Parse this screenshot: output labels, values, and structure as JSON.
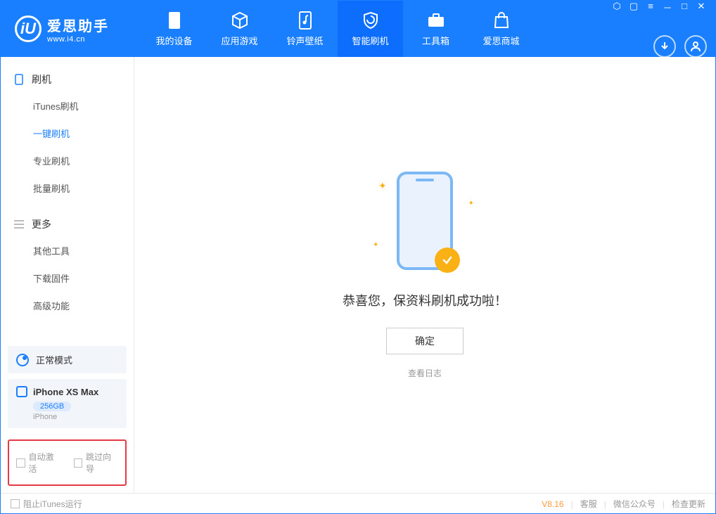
{
  "app": {
    "title": "爱思助手",
    "subtitle": "www.i4.cn"
  },
  "nav": {
    "mydevice": "我的设备",
    "apps": "应用游戏",
    "ringtone": "铃声壁纸",
    "flash": "智能刷机",
    "toolbox": "工具箱",
    "store": "爱思商城"
  },
  "sidebar": {
    "section_flash": "刷机",
    "items_flash": {
      "itunes": "iTunes刷机",
      "onekey": "一键刷机",
      "pro": "专业刷机",
      "batch": "批量刷机"
    },
    "section_more": "更多",
    "items_more": {
      "other": "其他工具",
      "firmware": "下载固件",
      "advanced": "高级功能"
    },
    "mode": "正常模式",
    "device": {
      "name": "iPhone XS Max",
      "capacity": "256GB",
      "type": "iPhone"
    },
    "opt_auto_activate": "自动激活",
    "opt_skip_guide": "跳过向导"
  },
  "main": {
    "success_msg": "恭喜您，保资料刷机成功啦！",
    "ok_btn": "确定",
    "view_log": "查看日志"
  },
  "footer": {
    "block_itunes": "阻止iTunes运行",
    "version": "V8.16",
    "service": "客服",
    "wechat": "微信公众号",
    "update": "检查更新"
  }
}
